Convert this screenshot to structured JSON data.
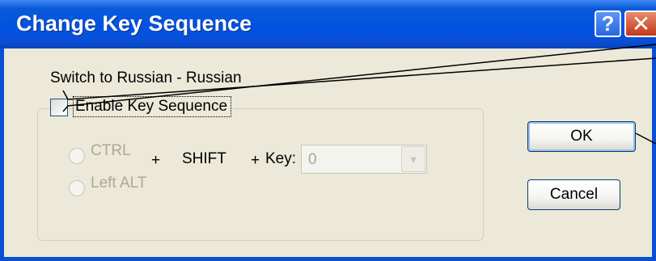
{
  "window": {
    "title": "Change Key Sequence"
  },
  "titlebar": {
    "help_label": "?",
    "close_label": "✕"
  },
  "dialog": {
    "description": "Switch to Russian - Russian",
    "enable_checkbox": {
      "label": "Enable Key Sequence",
      "checked": false
    },
    "modifier_options": [
      {
        "label": "CTRL",
        "selected": false
      },
      {
        "label": "Left ALT",
        "selected": false
      }
    ],
    "plus_symbol": "+",
    "shift_label": "SHIFT",
    "key_label": "Key:",
    "key_select": {
      "value": "0"
    }
  },
  "buttons": {
    "ok": "OK",
    "cancel": "Cancel"
  }
}
